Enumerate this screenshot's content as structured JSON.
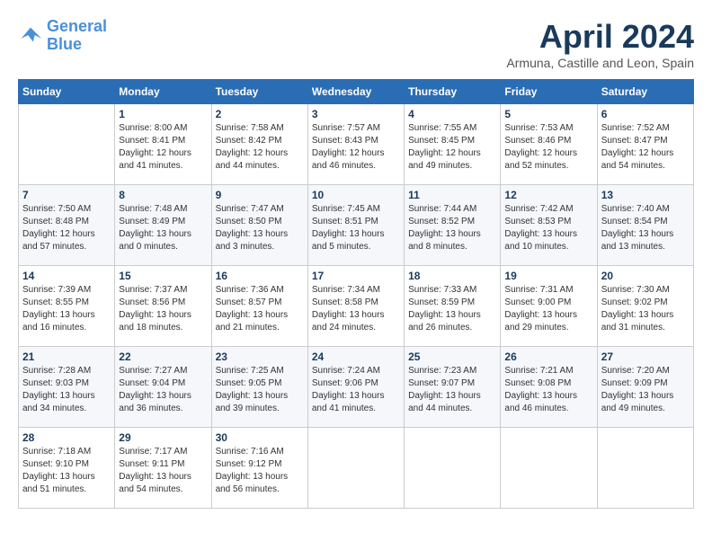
{
  "header": {
    "logo_line1": "General",
    "logo_line2": "Blue",
    "title": "April 2024",
    "subtitle": "Armuna, Castille and Leon, Spain"
  },
  "calendar": {
    "headers": [
      "Sunday",
      "Monday",
      "Tuesday",
      "Wednesday",
      "Thursday",
      "Friday",
      "Saturday"
    ],
    "weeks": [
      [
        {
          "day": "",
          "info": ""
        },
        {
          "day": "1",
          "info": "Sunrise: 8:00 AM\nSunset: 8:41 PM\nDaylight: 12 hours\nand 41 minutes."
        },
        {
          "day": "2",
          "info": "Sunrise: 7:58 AM\nSunset: 8:42 PM\nDaylight: 12 hours\nand 44 minutes."
        },
        {
          "day": "3",
          "info": "Sunrise: 7:57 AM\nSunset: 8:43 PM\nDaylight: 12 hours\nand 46 minutes."
        },
        {
          "day": "4",
          "info": "Sunrise: 7:55 AM\nSunset: 8:45 PM\nDaylight: 12 hours\nand 49 minutes."
        },
        {
          "day": "5",
          "info": "Sunrise: 7:53 AM\nSunset: 8:46 PM\nDaylight: 12 hours\nand 52 minutes."
        },
        {
          "day": "6",
          "info": "Sunrise: 7:52 AM\nSunset: 8:47 PM\nDaylight: 12 hours\nand 54 minutes."
        }
      ],
      [
        {
          "day": "7",
          "info": "Sunrise: 7:50 AM\nSunset: 8:48 PM\nDaylight: 12 hours\nand 57 minutes."
        },
        {
          "day": "8",
          "info": "Sunrise: 7:48 AM\nSunset: 8:49 PM\nDaylight: 13 hours\nand 0 minutes."
        },
        {
          "day": "9",
          "info": "Sunrise: 7:47 AM\nSunset: 8:50 PM\nDaylight: 13 hours\nand 3 minutes."
        },
        {
          "day": "10",
          "info": "Sunrise: 7:45 AM\nSunset: 8:51 PM\nDaylight: 13 hours\nand 5 minutes."
        },
        {
          "day": "11",
          "info": "Sunrise: 7:44 AM\nSunset: 8:52 PM\nDaylight: 13 hours\nand 8 minutes."
        },
        {
          "day": "12",
          "info": "Sunrise: 7:42 AM\nSunset: 8:53 PM\nDaylight: 13 hours\nand 10 minutes."
        },
        {
          "day": "13",
          "info": "Sunrise: 7:40 AM\nSunset: 8:54 PM\nDaylight: 13 hours\nand 13 minutes."
        }
      ],
      [
        {
          "day": "14",
          "info": "Sunrise: 7:39 AM\nSunset: 8:55 PM\nDaylight: 13 hours\nand 16 minutes."
        },
        {
          "day": "15",
          "info": "Sunrise: 7:37 AM\nSunset: 8:56 PM\nDaylight: 13 hours\nand 18 minutes."
        },
        {
          "day": "16",
          "info": "Sunrise: 7:36 AM\nSunset: 8:57 PM\nDaylight: 13 hours\nand 21 minutes."
        },
        {
          "day": "17",
          "info": "Sunrise: 7:34 AM\nSunset: 8:58 PM\nDaylight: 13 hours\nand 24 minutes."
        },
        {
          "day": "18",
          "info": "Sunrise: 7:33 AM\nSunset: 8:59 PM\nDaylight: 13 hours\nand 26 minutes."
        },
        {
          "day": "19",
          "info": "Sunrise: 7:31 AM\nSunset: 9:00 PM\nDaylight: 13 hours\nand 29 minutes."
        },
        {
          "day": "20",
          "info": "Sunrise: 7:30 AM\nSunset: 9:02 PM\nDaylight: 13 hours\nand 31 minutes."
        }
      ],
      [
        {
          "day": "21",
          "info": "Sunrise: 7:28 AM\nSunset: 9:03 PM\nDaylight: 13 hours\nand 34 minutes."
        },
        {
          "day": "22",
          "info": "Sunrise: 7:27 AM\nSunset: 9:04 PM\nDaylight: 13 hours\nand 36 minutes."
        },
        {
          "day": "23",
          "info": "Sunrise: 7:25 AM\nSunset: 9:05 PM\nDaylight: 13 hours\nand 39 minutes."
        },
        {
          "day": "24",
          "info": "Sunrise: 7:24 AM\nSunset: 9:06 PM\nDaylight: 13 hours\nand 41 minutes."
        },
        {
          "day": "25",
          "info": "Sunrise: 7:23 AM\nSunset: 9:07 PM\nDaylight: 13 hours\nand 44 minutes."
        },
        {
          "day": "26",
          "info": "Sunrise: 7:21 AM\nSunset: 9:08 PM\nDaylight: 13 hours\nand 46 minutes."
        },
        {
          "day": "27",
          "info": "Sunrise: 7:20 AM\nSunset: 9:09 PM\nDaylight: 13 hours\nand 49 minutes."
        }
      ],
      [
        {
          "day": "28",
          "info": "Sunrise: 7:18 AM\nSunset: 9:10 PM\nDaylight: 13 hours\nand 51 minutes."
        },
        {
          "day": "29",
          "info": "Sunrise: 7:17 AM\nSunset: 9:11 PM\nDaylight: 13 hours\nand 54 minutes."
        },
        {
          "day": "30",
          "info": "Sunrise: 7:16 AM\nSunset: 9:12 PM\nDaylight: 13 hours\nand 56 minutes."
        },
        {
          "day": "",
          "info": ""
        },
        {
          "day": "",
          "info": ""
        },
        {
          "day": "",
          "info": ""
        },
        {
          "day": "",
          "info": ""
        }
      ]
    ]
  }
}
